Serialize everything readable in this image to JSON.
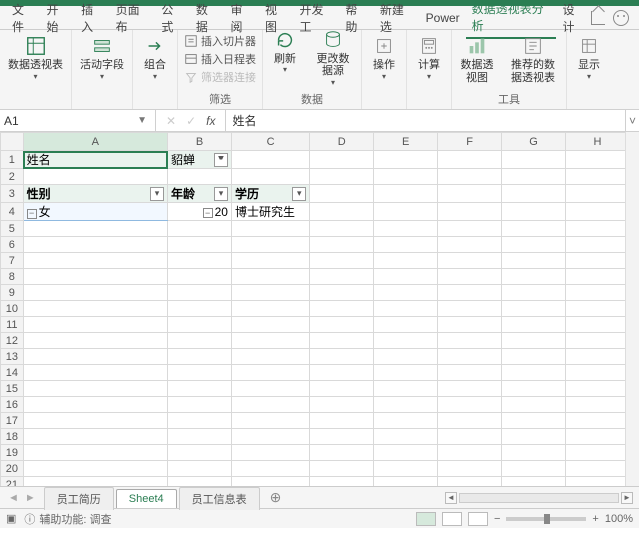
{
  "menu": {
    "items": [
      "文件",
      "开始",
      "插入",
      "页面布",
      "公式",
      "数据",
      "审阅",
      "视图",
      "开发工",
      "帮助",
      "新建选",
      "Power",
      "数据透视表分析",
      "设计"
    ]
  },
  "ribbon": {
    "pivot_table": "数据透视表",
    "active_field": "活动字段",
    "group": "组合",
    "insert_slicer": "插入切片器",
    "insert_timeline": "插入日程表",
    "filter_conn": "筛选器连接",
    "filter_label": "筛选",
    "refresh": "刷新",
    "change_ds": "更改数据源",
    "data_label": "数据",
    "actions": "操作",
    "calc": "计算",
    "pivot_chart": "数据透视图",
    "rec_pivot": "推荐的数据透视表",
    "tools_label": "工具",
    "show": "显示"
  },
  "fx": {
    "cell_ref": "A1",
    "value": "姓名"
  },
  "columns": [
    "A",
    "B",
    "C",
    "D",
    "E",
    "F",
    "G",
    "H"
  ],
  "rows_count": 21,
  "cells": {
    "a1": "姓名",
    "b1": "貂蝉",
    "a3": "性别",
    "b3": "年龄",
    "c3": "学历",
    "a4_indent": "女",
    "b4": "20",
    "c4": "博士研究生"
  },
  "tabs": {
    "items": [
      "员工简历",
      "Sheet4",
      "员工信息表"
    ],
    "active": 1
  },
  "status": {
    "text": "辅助功能: 调查",
    "zoom": "100%"
  }
}
